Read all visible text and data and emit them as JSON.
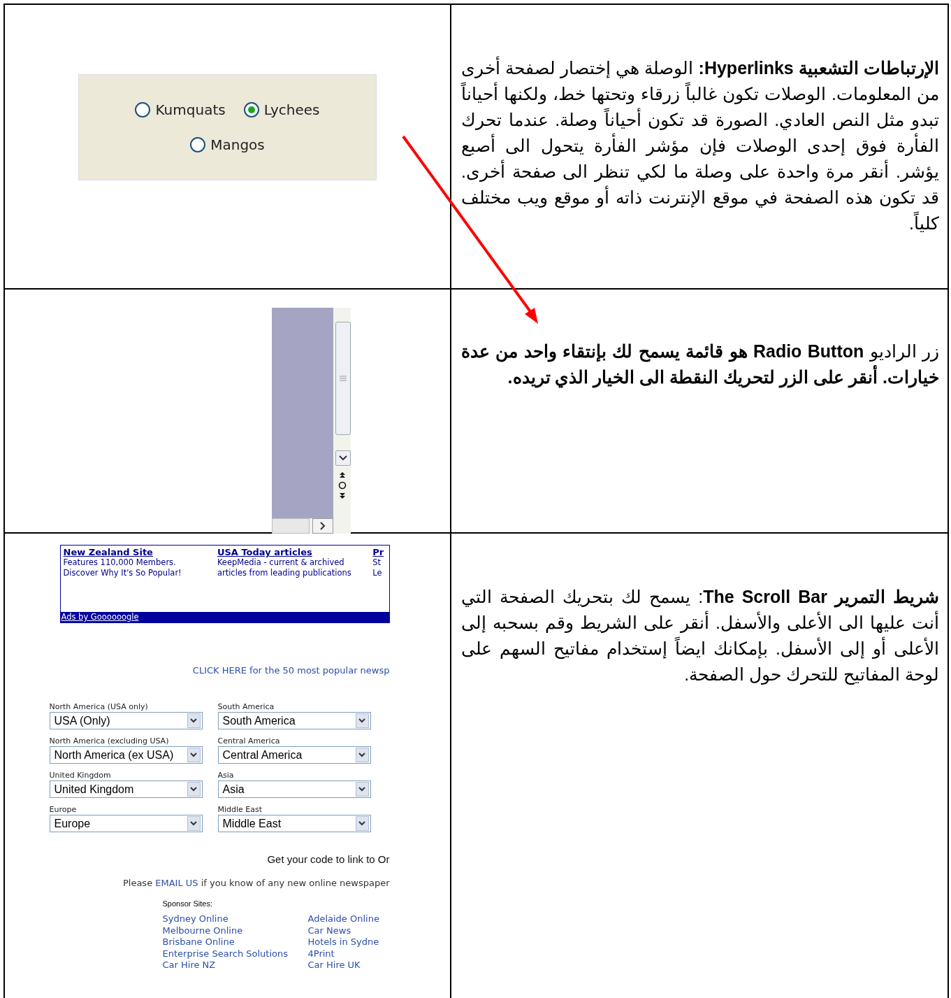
{
  "rows": [
    {
      "kind": "radio",
      "radios": [
        {
          "label": "Kumquats",
          "selected": false
        },
        {
          "label": "Lychees",
          "selected": true
        },
        {
          "label": "Mangos",
          "selected": false
        }
      ],
      "text": "**الإرتباطات التشعبية Hyperlinks:** الوصلة هي إختصار لصفحة أخرى من المعلومات. الوصلات تكون غالباً زرقاء وتحتها خط، ولكنها أحياناً تبدو مثل النص العادي. الصورة قد تكون أحياناً وصلة. عندما تحرك الفأرة فوق إحدى الوصلات فإن مؤشر الفأرة يتحول الى أصبع يؤشر. أنقر مرة واحدة على وصلة ما لكي تنظر الى صفحة أخرى. قد تكون هذه الصفحة في موقع الإنترنت ذاته أو موقع ويب مختلف كلياً."
    },
    {
      "kind": "scrollbar",
      "text": "زر الراديو **Radio Button هو قائمة يسمح لك بإنتقاء واحد من عدة خيارات. أنقر على الزر لتحريك النقطة الى الخيار الذي تريده.**"
    },
    {
      "kind": "webpage",
      "ads": {
        "columns": [
          {
            "title": "New Zealand Site",
            "body": "Features 110,000 Members. Discover Why It's So Popular!"
          },
          {
            "title": "USA Today articles",
            "body": "KeepMedia - current & archived articles from leading publications"
          },
          {
            "title": "Pr",
            "body": "St Le"
          }
        ],
        "footer": "Ads by Goooooogle"
      },
      "notice": "CLICK HERE for the 50 most popular newsp",
      "selects": [
        {
          "label": "North America (USA only)",
          "value": "USA (Only)"
        },
        {
          "label": "South America",
          "value": "South America"
        },
        {
          "label": "North America (excluding USA)",
          "value": "North America (ex USA)"
        },
        {
          "label": "Central America",
          "value": "Central America"
        },
        {
          "label": "United Kingdom",
          "value": "United Kingdom"
        },
        {
          "label": "Asia",
          "value": "Asia"
        },
        {
          "label": "Europe",
          "value": "Europe"
        },
        {
          "label": "Middle East",
          "value": "Middle East"
        }
      ],
      "code_line": "Get your code to link to Or",
      "email_line": {
        "before": "Please",
        "link": "EMAIL US",
        "after": "if you know of any new online newspaper"
      },
      "sponsors_label": "Sponsor Sites:",
      "sponsors": [
        "Sydney Online",
        "Adelaide Online",
        "Melbourne Online",
        "Car News",
        "Brisbane Online",
        "Hotels in Sydne",
        "Enterprise Search Solutions",
        "4Print",
        "Car Hire NZ",
        "Car Hire UK"
      ],
      "text": "**شريط التمرير The Scroll Bar**: يسمح لك بتحريك الصفحة التي أنت عليها الى الأعلى والأسفل. أنقر على الشريط وقم بسحبه إلى الأعلى أو إلى الأسفل.  بإمكانك ايضاً إستخدام مفاتيح السهم على لوحة المفاتيح للتحرك حول الصفحة."
    }
  ]
}
